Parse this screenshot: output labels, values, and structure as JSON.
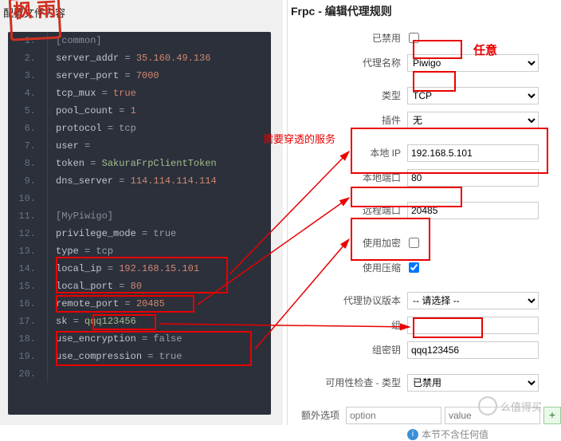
{
  "editor": {
    "title_label": "配置文件内容",
    "lines": [
      {
        "n": "1.",
        "kw": "",
        "raw": "[common]",
        "cls": "sec"
      },
      {
        "n": "2.",
        "kw": "server_addr",
        "val": "35.160.49.136"
      },
      {
        "n": "3.",
        "kw": "server_port",
        "val": "7000"
      },
      {
        "n": "4.",
        "kw": "tcp_mux",
        "val": "true"
      },
      {
        "n": "5.",
        "kw": "pool_count",
        "val": "1"
      },
      {
        "n": "6.",
        "kw": "protocol",
        "op": "= tcp",
        "plain": true
      },
      {
        "n": "7.",
        "kw": "user",
        "op": "= ",
        "plain": true
      },
      {
        "n": "8.",
        "kw": "token",
        "op": "= ",
        "str": "SakuraFrpClientToken"
      },
      {
        "n": "9.",
        "kw": "dns_server",
        "val": "114.114.114.114"
      },
      {
        "n": "10.",
        "kw": "",
        "raw": "",
        "cls": ""
      },
      {
        "n": "11.",
        "kw": "",
        "raw": "[MyPiwigo]",
        "cls": "sec"
      },
      {
        "n": "12.",
        "kw": "privilege_mode",
        "op": "= true",
        "plain": true
      },
      {
        "n": "13.",
        "kw": "type",
        "op": "= tcp",
        "plain": true
      },
      {
        "n": "14.",
        "kw": "local_ip",
        "val": "192.168.15.101"
      },
      {
        "n": "15.",
        "kw": "local_port",
        "val": "80"
      },
      {
        "n": "16.",
        "kw": "remote_port",
        "val": "20485"
      },
      {
        "n": "17.",
        "kw": "sk",
        "op": "= ",
        "str": "qqq123456"
      },
      {
        "n": "18.",
        "kw": "use_encryption",
        "op": "= false",
        "plain": true
      },
      {
        "n": "19.",
        "kw": "use_compression",
        "op": "= true",
        "plain": true
      },
      {
        "n": "20.",
        "kw": "",
        "raw": "",
        "cls": ""
      }
    ]
  },
  "form": {
    "title": "Frpc - 编辑代理规则",
    "fields": {
      "disabled_label": "已禁用",
      "proxy_name_label": "代理名称",
      "proxy_name_value": "Piwigo",
      "type_label": "类型",
      "type_value": "TCP",
      "plugin_label": "插件",
      "plugin_value": "无",
      "local_ip_label": "本地 IP",
      "local_ip_value": "192.168.5.101",
      "local_port_label": "本地端口",
      "local_port_value": "80",
      "remote_port_label": "远程端口",
      "remote_port_value": "20485",
      "use_encryption_label": "使用加密",
      "use_compression_label": "使用压缩",
      "proxy_protocol_label": "代理协议版本",
      "proxy_protocol_value": "-- 请选择 --",
      "group_label": "组",
      "group_value": "",
      "group_key_label": "组密钥",
      "group_key_value": "qqq123456",
      "health_check_label": "可用性检查 - 类型",
      "health_check_value": "已禁用",
      "extra_opts_label": "额外选项",
      "extra_opt_placeholder_key": "option",
      "extra_opt_placeholder_val": "value",
      "empty_list": "本节不含任何值"
    }
  },
  "annotations": {
    "any": "任意",
    "service_needed": "需要穿透的服务"
  },
  "watermark": {
    "stamp": "枫\n雨",
    "footer": "么值得买"
  }
}
